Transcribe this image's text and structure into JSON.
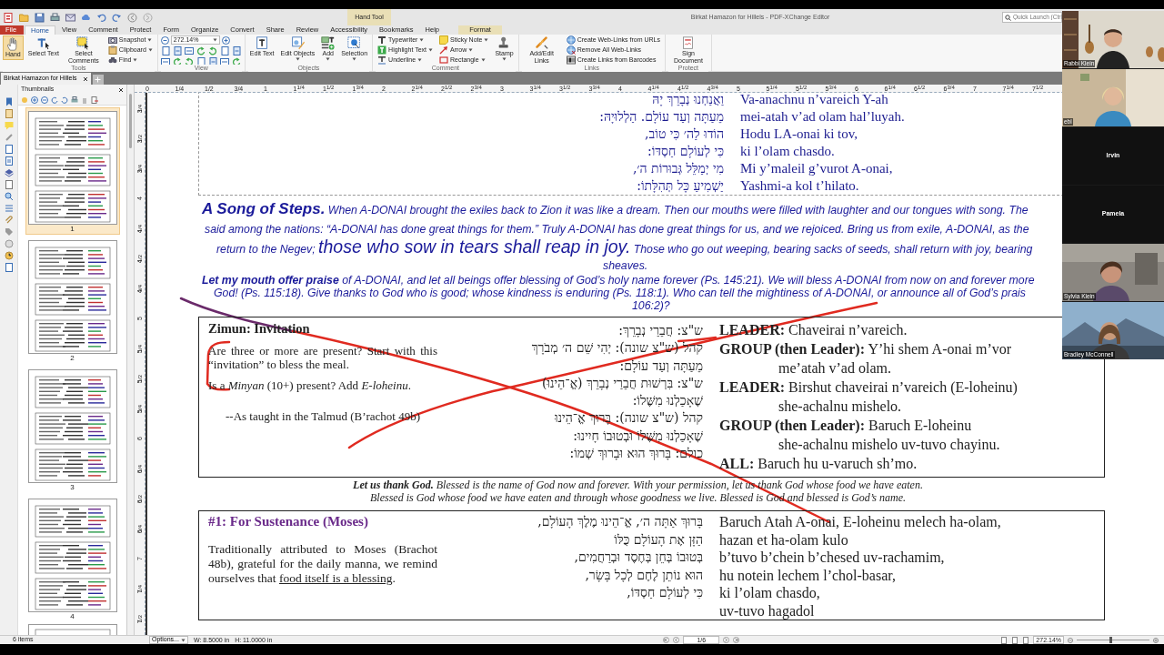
{
  "window": {
    "title": "Birkat Hamazon for Hillels - PDF-XChange Editor",
    "context_group": "Hand Tool",
    "quick_launch": {
      "placeholder": "Quick Launch (Ctrl"
    }
  },
  "menu_tabs": [
    {
      "label": "File",
      "kind": "file",
      "selected": false
    },
    {
      "label": "Home",
      "kind": "tab",
      "selected": true
    },
    {
      "label": "View",
      "kind": "tab",
      "selected": false
    },
    {
      "label": "Comment",
      "kind": "tab",
      "selected": false
    },
    {
      "label": "Protect",
      "kind": "tab",
      "selected": false
    },
    {
      "label": "Form",
      "kind": "tab",
      "selected": false
    },
    {
      "label": "Organize",
      "kind": "tab",
      "selected": false
    },
    {
      "label": "Convert",
      "kind": "tab",
      "selected": false
    },
    {
      "label": "Share",
      "kind": "tab",
      "selected": false
    },
    {
      "label": "Review",
      "kind": "tab",
      "selected": false
    },
    {
      "label": "Accessibility",
      "kind": "tab",
      "selected": false
    },
    {
      "label": "Bookmarks",
      "kind": "tab",
      "selected": false
    },
    {
      "label": "Help",
      "kind": "tab",
      "selected": false
    },
    {
      "label": "Format",
      "kind": "context",
      "selected": false
    }
  ],
  "ribbon": [
    {
      "label": "Tools",
      "items": [
        {
          "kind": "large",
          "label": "Hand",
          "selected": true,
          "dropdown": false
        },
        {
          "kind": "large",
          "label": "Select Text",
          "selected": false,
          "dropdown": false
        },
        {
          "kind": "large",
          "label": "Select Comments",
          "selected": false,
          "dropdown": false
        },
        {
          "kind": "small",
          "label": "Snapshot",
          "selected": false,
          "dropdown": true
        },
        {
          "kind": "small",
          "label": "Clipboard",
          "selected": false,
          "dropdown": true
        },
        {
          "kind": "small",
          "label": "Find",
          "selected": false,
          "dropdown": true
        }
      ]
    },
    {
      "label": "View",
      "items": [
        {
          "kind": "combo",
          "value": "272.14%"
        },
        {
          "kind": "icon_grid"
        }
      ]
    },
    {
      "label": "Objects",
      "items": [
        {
          "kind": "large",
          "label": "Edit Text",
          "selected": false,
          "dropdown": false
        },
        {
          "kind": "large",
          "label": "Edit Objects",
          "selected": false,
          "dropdown": true
        },
        {
          "kind": "large",
          "label": "Add",
          "selected": false,
          "dropdown": true
        },
        {
          "kind": "large",
          "label": "Selection",
          "selected": false,
          "dropdown": true
        }
      ]
    },
    {
      "label": "Comment",
      "items": [
        {
          "kind": "small",
          "label": "Typewriter",
          "selected": false,
          "dropdown": true
        },
        {
          "kind": "small",
          "label": "Highlight Text",
          "selected": false,
          "dropdown": true
        },
        {
          "kind": "small",
          "label": "Underline",
          "selected": false,
          "dropdown": true
        },
        {
          "kind": "small",
          "label": "Sticky Note",
          "selected": false,
          "dropdown": true
        },
        {
          "kind": "small",
          "label": "Arrow",
          "selected": false,
          "dropdown": true
        },
        {
          "kind": "small",
          "label": "Rectangle",
          "selected": false,
          "dropdown": true
        },
        {
          "kind": "large",
          "label": "Stamp",
          "selected": false,
          "dropdown": true
        }
      ]
    },
    {
      "label": "Links",
      "items": [
        {
          "kind": "large",
          "label": "Add/Edit Links",
          "selected": false,
          "dropdown": false
        },
        {
          "kind": "small",
          "label": "Create Web-Links from URLs",
          "selected": false,
          "dropdown": false
        },
        {
          "kind": "small",
          "label": "Remove All Web-Links",
          "selected": false,
          "dropdown": false
        },
        {
          "kind": "small",
          "label": "Create Links from Barcodes",
          "selected": false,
          "dropdown": false
        }
      ]
    },
    {
      "label": "Protect",
      "items": [
        {
          "kind": "large",
          "label": "Sign Document",
          "selected": false,
          "dropdown": false
        }
      ]
    }
  ],
  "document_tabs": [
    {
      "label": "Birkat Hamazon for Hillels",
      "selected": true
    }
  ],
  "side_panel": {
    "title": "Thumbnails",
    "thumbnails": [
      {
        "label": "1",
        "selected": true
      },
      {
        "label": "2",
        "selected": false
      },
      {
        "label": "3",
        "selected": false
      },
      {
        "label": "4",
        "selected": false
      }
    ]
  },
  "ruler": {
    "horizontal": [
      "0",
      "1/4",
      "1/2",
      "3/4",
      "1",
      "1$^{1/4}$",
      "1$^{1/2}$",
      "1$^{3/4}$",
      "2",
      "2$^{1/4}$",
      "2$^{1/2}$",
      "2$^{3/4}$",
      "3",
      "3$^{1/4}$",
      "3$^{1/2}$",
      "3$^{3/4}$",
      "4",
      "4$^{1/4}$",
      "4$^{1/2}$",
      "4$^{3/4}$",
      "5",
      "5$^{1/4}$",
      "5$^{1/2}$",
      "5$^{3/4}$",
      "6",
      "6$^{1/4}$",
      "6$^{1/2}$",
      "6$^{3/4}$",
      "7",
      "7$^{1/4}$",
      "7$^{1/2}$"
    ],
    "vertical": [
      "3$^{1/4}$",
      "3$^{1/2}$",
      "3$^{3/4}$",
      "4",
      "4$^{1/4}$",
      "4$^{1/2}$",
      "4$^{3/4}$",
      "5",
      "5$^{1/4}$",
      "5$^{1/2}$",
      "5$^{3/4}$",
      "6",
      "6$^{1/4}$",
      "6$^{1/2}$",
      "6$^{3/4}$",
      "7",
      "7$^{1/4}$",
      "7$^{1/2}$"
    ]
  },
  "document": {
    "psalm_rows": [
      {
        "hebrew": "וַאֲנַחְנוּ נְבָרֵךְ יָהּ",
        "english": "Va-anachnu n’vareich Y-ah"
      },
      {
        "hebrew": "מֵעַתָּה וְעַד עוֹלָם. הַלְלוּיָהּ:",
        "english": "mei-atah v’ad olam hal’luyah."
      },
      {
        "hebrew": "הוֹדוּ לַה׳ כִּי טוֹב,",
        "english": "Hodu LA-onai ki tov,"
      },
      {
        "hebrew": "כִּי לְעוֹלָם חַסְדּוֹ:",
        "english": "ki l’olam chasdo."
      },
      {
        "hebrew": "מִי יְמַלֵּל גְּבוּרוֹת ה׳,",
        "english": "Mi y’maleil g’vurot A-onai,"
      },
      {
        "hebrew": "יַשְׁמִיעַ כָּל תְּהִלָּתוֹ:",
        "english": "Yashmi-a kol t’hilato."
      }
    ],
    "song": [
      [
        {
          "kind": "heading",
          "text": "A Song of Steps."
        },
        {
          "kind": "body",
          "text": " When A-DONAI brought the exiles back to Zion it was like a dream. Then our mouths were filled with laughter and our tongues with song. The"
        }
      ],
      [
        {
          "kind": "body",
          "text": "said among the nations: “A-DONAI has done great things for them.” Truly A-DONAI has done great things for us, and we rejoiced. Bring us from exile, A-DONAI, as the"
        }
      ],
      [
        {
          "kind": "body",
          "text": "return to the Negev; "
        },
        {
          "kind": "large",
          "text": "those who sow in tears shall reap in joy."
        },
        {
          "kind": "body",
          "text": " Those who go out weeping, bearing sacks of seeds, shall return with joy, bearing"
        }
      ],
      [
        {
          "kind": "body",
          "text": "sheaves."
        }
      ]
    ],
    "praise": [
      "**Let my mouth offer praise** of A-DONAI, and let all beings offer blessing of God’s holy name forever (Ps. 145:21). We will bless A-DONAI from now on and forever more",
      "God! (Ps. 115:18).  Give thanks to God who is good; whose kindness is enduring (Ps. 118:1).  Who can tell the mightiness of A-DONAI, or announce all of God’s prais",
      "106:2)?"
    ],
    "zimun": {
      "title": "Zimun: Invitation",
      "notes": [
        {
          "kind": "note",
          "text": "Are three or more are present? Start with this “invitation” to bless the meal."
        },
        {
          "kind": "note",
          "text": "Is a *Minyan* (10+) present? Add *E-loheinu*."
        },
        {
          "kind": "source",
          "text": "--As taught in the Talmud (B’rachot 49b)"
        }
      ],
      "hebrew": [
        "ש\"צ: חֲבֵרַי נְבָרֵךְ:",
        "קהל (ש\"צ שונה): יְהִי שֵׁם ה׳ מְבֹרָךְ",
        "מֵעַתָּה וְעַד עוֹלָם:",
        "ש\"צ: בִּרְשׁוּת חֲבֵרַי נְבָרֵךְ (אֱ־הֵינוּ)",
        "שֶׁאָכַלְנוּ מִשֶּׁלוֹ:",
        "קהל (ש\"צ שונה): בָּרוּךְ אֱ־הֵינוּ",
        "שֶׁאָכַלְנוּ מִשֶּׁלוֹ וּבְטוּבוֹ חָיִינוּ:",
        "כולם: בָּרוּךְ הוּא וּבָרוּךְ שְׁמוֹ:"
      ],
      "english": [
        {
          "text": "**LEADER:** Chaveirai n’vareich.",
          "continuation": false
        },
        {
          "text": "**GROUP (then Leader):** Y’hi shem A-onai  m’vor",
          "continuation": false
        },
        {
          "text": "me’atah v’ad olam.",
          "continuation": true
        },
        {
          "text": "**LEADER:** Birshut chaveirai n’vareich (E-loheinu)",
          "continuation": false
        },
        {
          "text": "she-achalnu mishelo.",
          "continuation": true
        },
        {
          "text": "**GROUP (then Leader):** Baruch E-loheinu",
          "continuation": false
        },
        {
          "text": "she-achalnu mishelo uv-tuvo chayinu.",
          "continuation": true
        },
        {
          "text": "**ALL:** Baruch hu u-varuch sh’mo.",
          "continuation": false
        }
      ]
    },
    "thanks": [
      "**Let us thank God.** Blessed is the name of God now and forever. With your permission, let us thank God whose food we have eaten.",
      "Blessed is God whose food we have eaten and through whose goodness we live. Blessed is God and blessed is God’s name."
    ],
    "sustenance": {
      "title": "#1: For Sustenance (Moses)",
      "note": "Traditionally attributed to Moses (Brachot 48b), grateful for the daily manna, we remind ourselves that ",
      "note_underlined": "food itself is a blessing",
      "note_end": ".",
      "hebrew": [
        "בָּרוּךְ אַתָּה ה׳, אֱ־הֵינוּ מֶלֶךְ הָעוֹלָם,",
        "הַזָּן אֶת הָעוֹלָם כֻּלּוֹ",
        "בְּטוּבוֹ בְּחֵן בְּחֶסֶד וּבְרַחֲמִים,",
        "הוּא נוֹתֵן לֶחֶם לְכָל בָּשָׂר,",
        "כִּי לְעוֹלָם חַסְדּוֹ,"
      ],
      "english": [
        "Baruch Atah A-onai, E-loheinu melech ha-olam,",
        "hazan et ha-olam kulo",
        "b’tuvo b’chein b’chesed uv-rachamim,",
        "hu notein lechem l’chol-basar,",
        "ki l’olam chasdo,",
        "uv-tuvo hagadol"
      ]
    }
  },
  "status_bar": {
    "items": "6 items",
    "options": "Options...",
    "width": "W: 8.5000 in",
    "height": "H: 11.0000 in",
    "page": "1/6",
    "zoom": "272.14%",
    "slider": {
      "level": 0.47
    }
  },
  "video_tiles": [
    {
      "name": "Rabbi Klein",
      "video": true
    },
    {
      "name": "ebl",
      "video": true
    },
    {
      "name": "Irvin",
      "video": false
    },
    {
      "name": "Pamela",
      "video": false
    },
    {
      "name": "Sylvia Klein",
      "video": true
    },
    {
      "name": "Bradley McConnell",
      "video": true
    }
  ]
}
